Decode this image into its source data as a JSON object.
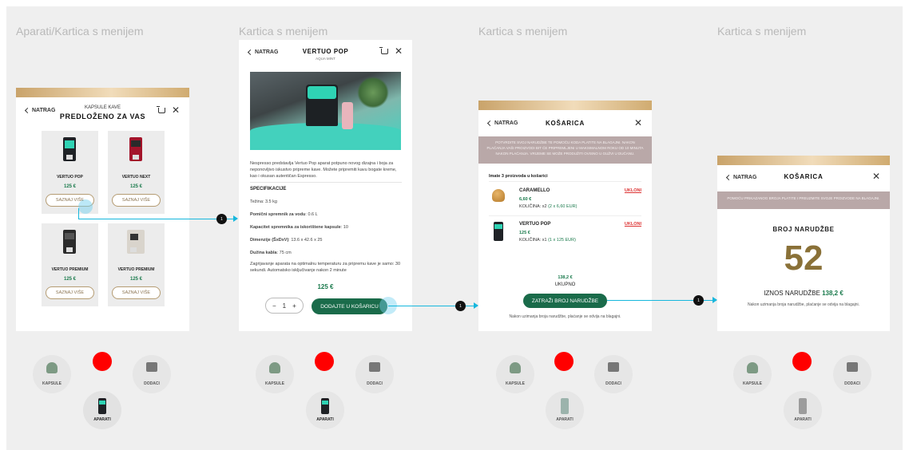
{
  "frames": [
    {
      "label": "Aparati/Kartica s menijem"
    },
    {
      "label": "Kartica s menijem"
    },
    {
      "label": "Kartica s menijem"
    },
    {
      "label": "Kartica s menijem"
    }
  ],
  "screen1": {
    "back": "NATRAG",
    "subtitle": "KAPSULE KAVE",
    "title": "PREDLOŽENO ZA VAS",
    "products": [
      {
        "name": "VERTUO POP",
        "price": "125 €",
        "button": "SAZNAJ VIŠE",
        "color": "#1f2226",
        "accent": "#2fd3b4"
      },
      {
        "name": "VERTUO NEXT",
        "price": "125 €",
        "button": "SAZNAJ VIŠE",
        "color": "#a3142a",
        "accent": "#2a2a2a"
      },
      {
        "name": "VERTUO PREMIUM",
        "price": "125 €",
        "button": "SAZNAJ VIŠE",
        "color": "#2b2b2b",
        "accent": "#555555"
      },
      {
        "name": "VERTUO PREMIUM",
        "price": "125 €",
        "button": "SAZNAJ VIŠE",
        "color": "#d9d4cc",
        "accent": "#333333"
      }
    ]
  },
  "screen2": {
    "back": "NATRAG",
    "title": "VERTUO POP",
    "subtitle": "AQUA MINT",
    "description": "Nespresso predstavlja Vertuo Pop aparat potpuno novog dizajna i boja za neponovljivo iskustvo pripreme kave. Možete pripremiti kavu bogate kreme, kao i okusan autentičan Espresso.",
    "spec_title": "SPECIFIKACIJE",
    "specs": [
      {
        "key": "Težina",
        "value": ": 3.5 kg"
      },
      {
        "key": "Pomični spremnik za vodu",
        "value": ": 0.6 L"
      },
      {
        "key": "Kapacitet spremnika za iskorištene kapsule",
        "value": ": 10"
      },
      {
        "key": "Dimenzije (ŠxDxV)",
        "value": ": 13.6 x 42.6 x 25"
      },
      {
        "key": "Dužina kabla",
        "value": ": 75 cm"
      }
    ],
    "note": "Zagrijavanje aparata na optimalnu temperaturu za pripremu kave je samo: 30 sekundi. Automatsko isključivanje nakon 2 minute",
    "price": "125 €",
    "qty": "1",
    "minus": "−",
    "plus": "+",
    "add_button": "DODAJTE U KOŠARICU"
  },
  "screen3": {
    "back": "NATRAG",
    "title": "KOŠARICA",
    "banner": "POTVRDITE SVOJ NARUDŽBE TE POMOĆU KODA PLATITE NA BLAGAJNI. NAKON PLAĆANJA VAŠI PROIZVODI BIT ĆE PRIPREMLJENI U MAKSIMALNOM ROKU OD 10 MINUTA NAKON PLAĆANJA. VRIJEME SE MOŽE PRODUŽITI OVISNO U GUŽVI U DUĆANU.",
    "count_text": "Imate 3 proizvoda u košarici",
    "items": [
      {
        "name": "CARAMELLO",
        "price": "6,60 €",
        "qty_label": "KOLIČINA: x2",
        "qty_detail": "(2 x 6,60 EUR)",
        "remove": "UKLONI"
      },
      {
        "name": "VERTUO POP",
        "price": "125 €",
        "qty_label": "KOLIČINA: x1",
        "qty_detail": "(1 x 125 EUR)",
        "remove": "UKLONI"
      }
    ],
    "total": "138,2 €",
    "total_label": "UKUPNO",
    "button": "ZATRAŽI BROJ NARUDŽBE",
    "footer": "Nakon uzimanja broja narudžbe, plaćanje se odvija na blagajni."
  },
  "screen4": {
    "back": "NATRAG",
    "title": "KOŠARICA",
    "banner": "POMOĆU PRIKAZANOG BROJA PLATITE I PREUZMITE SVOJE PROIZVODE NA BLAGAJNI.",
    "order_label": "BROJ NARUDŽBE",
    "order_number": "52",
    "amount_label": "IZNOS NARUDŽBE",
    "amount": "138,2 €",
    "footer": "Nakon uzimanja broja narudžbe, plaćanje se odvija na blagajni."
  },
  "flow_steps": [
    "1",
    "1",
    "1"
  ],
  "nav": {
    "capsules": "KAPSULE",
    "accessories": "DODACI",
    "machines": "APARATI"
  },
  "colors": {
    "accent_green": "#1a6b4a",
    "price_green": "#1a7a4c",
    "flow": "#16b7dd",
    "gold": "#c9a36a",
    "order_number": "#8a7138",
    "red_dot": "#ff0000"
  }
}
